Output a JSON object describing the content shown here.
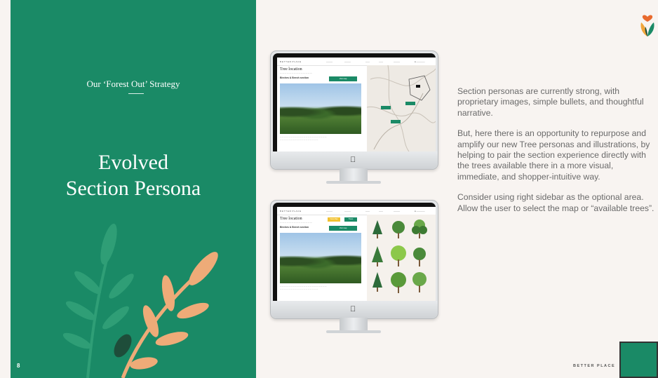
{
  "left_panel": {
    "kicker": "Our ‘Forest Out’ Strategy",
    "title_line1": "Evolved",
    "title_line2": "Section Persona",
    "page_number": "8",
    "bg_color": "#1a8a66"
  },
  "body": {
    "p1": "Section personas are currently strong, with proprietary images, simple bullets, and thoughtful narrative.",
    "p2": "But, here there is an opportunity to repurpose and amplify our new Tree personas and illustrations, by helping to pair the section experience directly with the trees available there in a more visual, immediate, and shopper-intuitive way.",
    "p3": "Consider using right sidebar as the optional area. Allow the user to select the map or “available trees”."
  },
  "footer": {
    "brand": "BETTER PLACE"
  },
  "mockup_top": {
    "heading": "Tree location",
    "section_label": "Birches & Beech section",
    "button_label": "Visit map"
  },
  "mockup_bottom": {
    "heading": "Tree location",
    "section_label": "Birches & Beech section",
    "button_label": "Visit map",
    "toggle_map": "View Map",
    "toggle_trees": "Trees"
  },
  "icons": {
    "logo": "heart-leaf-logo-icon",
    "apple": "apple-logo-icon"
  },
  "colors": {
    "accent_green": "#1a8a66",
    "leaf_peach": "#eeab78",
    "leaf_pale": "#2f9e76",
    "logo_orange": "#e86a2e"
  }
}
